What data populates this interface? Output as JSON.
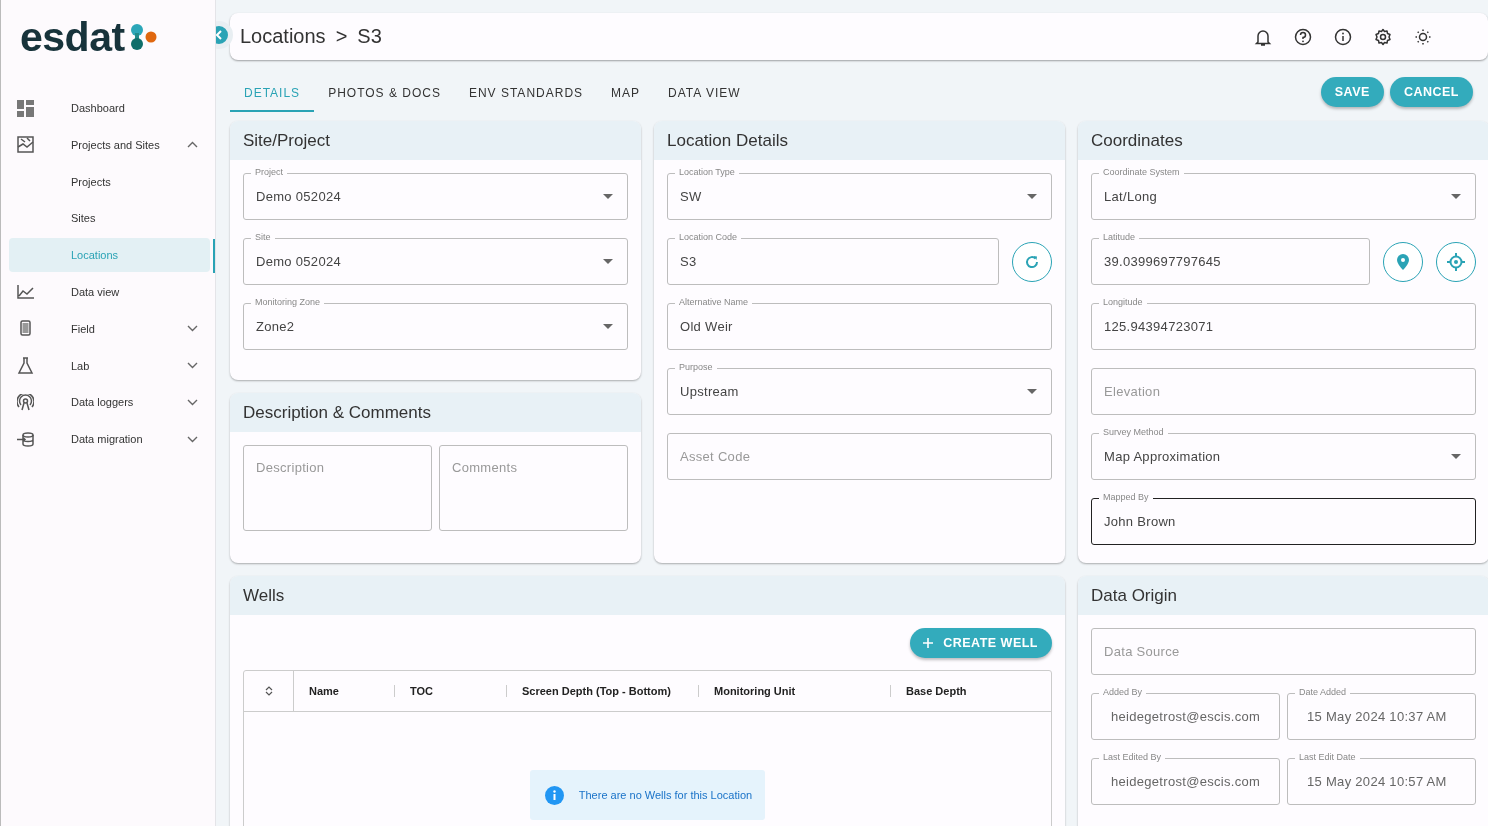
{
  "logo": {
    "text": "esdat"
  },
  "sidebar": {
    "items": [
      {
        "label": "Dashboard",
        "kind": "link",
        "selected": false
      },
      {
        "label": "Projects and Sites",
        "kind": "group",
        "expanded": true,
        "children": [
          {
            "label": "Projects",
            "selected": false
          },
          {
            "label": "Sites",
            "selected": false
          },
          {
            "label": "Locations",
            "selected": true
          }
        ]
      },
      {
        "label": "Data view",
        "kind": "link",
        "selected": false
      },
      {
        "label": "Field",
        "kind": "group",
        "expanded": false
      },
      {
        "label": "Lab",
        "kind": "group",
        "expanded": false
      },
      {
        "label": "Data loggers",
        "kind": "group",
        "expanded": false
      },
      {
        "label": "Data migration",
        "kind": "group",
        "expanded": false
      }
    ]
  },
  "breadcrumb": {
    "items": [
      "Locations",
      "S3"
    ],
    "separator": ">"
  },
  "tabs": [
    {
      "label": "DETAILS",
      "selected": true
    },
    {
      "label": "PHOTOS & DOCS",
      "selected": false
    },
    {
      "label": "ENV STANDARDS",
      "selected": false
    },
    {
      "label": "MAP",
      "selected": false
    },
    {
      "label": "DATA VIEW",
      "selected": false
    }
  ],
  "buttons": [
    "SAVE",
    "CANCEL"
  ],
  "site_project": {
    "title": "Site/Project",
    "fields": [
      {
        "kind": "select",
        "label": "Project",
        "value": "Demo 052024",
        "focused": false
      },
      {
        "kind": "select",
        "label": "Site",
        "value": "Demo 052024",
        "focused": false
      },
      {
        "kind": "select",
        "label": "Monitoring Zone",
        "value": "Zone2",
        "focused": false
      }
    ]
  },
  "description_comments": {
    "title": "Description & Comments",
    "fields": [
      {
        "kind": "area",
        "placeholder": "Description",
        "focused": false
      },
      {
        "kind": "area",
        "placeholder": "Comments",
        "focused": false
      }
    ]
  },
  "location_details": {
    "title": "Location Details",
    "fields": [
      {
        "kind": "select",
        "label": "Location Type",
        "value": "SW",
        "focused": false
      },
      {
        "kind": "text-refresh",
        "label": "Location Code",
        "value": "S3",
        "focused": false
      },
      {
        "kind": "text",
        "label": "Alternative Name",
        "value": "Old Weir",
        "focused": false
      },
      {
        "kind": "select",
        "label": "Purpose",
        "value": "Upstream",
        "focused": false
      },
      {
        "kind": "text",
        "placeholder": "Asset Code",
        "focused": false
      }
    ]
  },
  "coordinates": {
    "title": "Coordinates",
    "fields": [
      {
        "kind": "select",
        "label": "Coordinate System",
        "value": "Lat/Long",
        "focused": false
      },
      {
        "kind": "text-locate",
        "label": "Latitude",
        "value": "39.0399697797645",
        "focused": false
      },
      {
        "kind": "text",
        "label": "Longitude",
        "value": "125.94394723071",
        "focused": false
      },
      {
        "kind": "text",
        "placeholder": "Elevation",
        "focused": false
      },
      {
        "kind": "select",
        "label": "Survey Method",
        "value": "Map Approximation",
        "focused": false
      },
      {
        "kind": "text",
        "label": "Mapped By",
        "value": "John Brown",
        "focused": true
      }
    ]
  },
  "wells": {
    "title": "Wells",
    "create_button": "CREATE WELL",
    "table": {
      "columns": [
        "Name",
        "TOC",
        "Screen Depth (Top - Bottom)",
        "Monitoring Unit",
        "Base Depth"
      ]
    },
    "empty_message": "There are no Wells for this Location"
  },
  "data_origin": {
    "title": "Data Origin",
    "fields": [
      {
        "kind": "text",
        "placeholder": "Data Source",
        "focused": false
      },
      {
        "kind": "half",
        "label": "Added By",
        "value": "heidegetrost@escis.com",
        "focused": false
      },
      {
        "kind": "half",
        "label": "Date Added",
        "value": "15 May 2024 10:37 AM",
        "focused": false
      },
      {
        "kind": "half",
        "label": "Last Edited By",
        "value": "heidegetrost@escis.com",
        "focused": false
      },
      {
        "kind": "half",
        "label": "Last Edit Date",
        "value": "15 May 2024 10:57 AM",
        "focused": false
      }
    ]
  }
}
